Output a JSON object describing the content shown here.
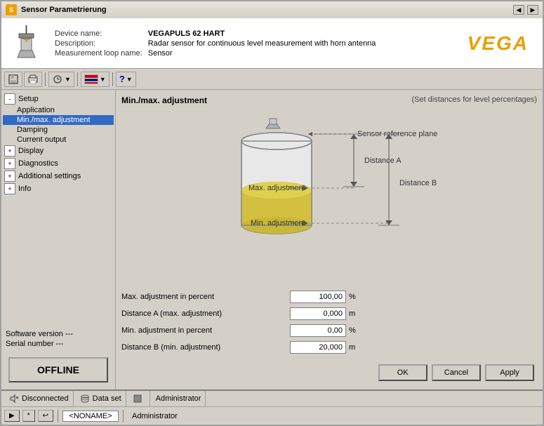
{
  "titleBar": {
    "title": "Sensor Parametrierung",
    "buttons": [
      "◀",
      "▶"
    ]
  },
  "deviceHeader": {
    "deviceNameLabel": "Device name:",
    "deviceNameValue": "VEGAPULS 62 HART",
    "descriptionLabel": "Description:",
    "descriptionValue": "Radar sensor for continuous level measurement with horn antenna",
    "measurementLoopLabel": "Measurement loop name:",
    "measurementLoopValue": "Sensor",
    "logoText": "VEGA"
  },
  "toolbar": {
    "buttons": [
      "💾",
      "🖨",
      "⚙",
      "🇬🇧",
      "❓"
    ]
  },
  "sidebar": {
    "items": [
      {
        "label": "Setup",
        "level": 0,
        "expanded": true,
        "hasExpander": true
      },
      {
        "label": "Application",
        "level": 1,
        "expanded": false,
        "hasExpander": false
      },
      {
        "label": "Min./max. adjustment",
        "level": 1,
        "expanded": false,
        "hasExpander": false,
        "selected": true
      },
      {
        "label": "Damping",
        "level": 1,
        "expanded": false,
        "hasExpander": false
      },
      {
        "label": "Current output",
        "level": 1,
        "expanded": false,
        "hasExpander": false
      },
      {
        "label": "Display",
        "level": 0,
        "expanded": false,
        "hasExpander": true
      },
      {
        "label": "Diagnostics",
        "level": 0,
        "expanded": false,
        "hasExpander": true
      },
      {
        "label": "Additional settings",
        "level": 0,
        "expanded": false,
        "hasExpander": true
      },
      {
        "label": "Info",
        "level": 0,
        "expanded": false,
        "hasExpander": true
      }
    ],
    "softwareVersion": "Software version  ---",
    "serialNumber": "Serial number        ---",
    "offlineButton": "OFFLINE"
  },
  "mainPanel": {
    "title": "Min./max. adjustment",
    "subtitle": "(Set distances for level percentages)",
    "diagram": {
      "sensorReferencePlane": "Sensor reference plane",
      "maxAdjustment": "Max. adjustment",
      "minAdjustment": "Min. adjustment",
      "distanceA": "Distance A",
      "distanceB": "Distance B"
    },
    "form": {
      "rows": [
        {
          "label": "Max. adjustment in percent",
          "value": "100,00",
          "unit": "%"
        },
        {
          "label": "Distance A (max. adjustment)",
          "value": "0,000",
          "unit": "m"
        },
        {
          "label": "Min. adjustment in percent",
          "value": "0,00",
          "unit": "%"
        },
        {
          "label": "Distance B (min. adjustment)",
          "value": "20,000",
          "unit": "m"
        }
      ]
    },
    "buttons": {
      "ok": "OK",
      "cancel": "Cancel",
      "apply": "Apply"
    }
  },
  "statusBar": {
    "items": [
      {
        "icon": "speaker",
        "label": "Disconnected"
      },
      {
        "icon": "dataset",
        "label": "Data set"
      },
      {
        "icon": "square",
        "label": ""
      },
      {
        "icon": "",
        "label": "Administrator"
      }
    ]
  },
  "taskbar": {
    "buttons": [
      "▶",
      "*",
      "↩"
    ],
    "field": "<NONAME>",
    "label": "Administrator"
  }
}
